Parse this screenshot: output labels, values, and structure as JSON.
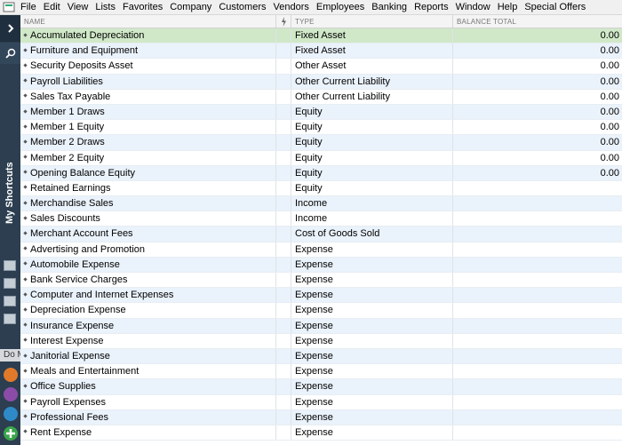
{
  "menu": [
    "File",
    "Edit",
    "View",
    "Lists",
    "Favorites",
    "Company",
    "Customers",
    "Vendors",
    "Employees",
    "Banking",
    "Reports",
    "Window",
    "Help",
    "Special Offers"
  ],
  "sidebar": {
    "title": "My Shortcuts",
    "do_label": "Do More"
  },
  "columns": {
    "name": "NAME",
    "type": "TYPE",
    "balance": "BALANCE TOTAL"
  },
  "accounts": [
    {
      "name": "Accumulated Depreciation",
      "type": "Fixed Asset",
      "balance": "0.00"
    },
    {
      "name": "Furniture and Equipment",
      "type": "Fixed Asset",
      "balance": "0.00"
    },
    {
      "name": "Security Deposits Asset",
      "type": "Other Asset",
      "balance": "0.00"
    },
    {
      "name": "Payroll Liabilities",
      "type": "Other Current Liability",
      "balance": "0.00"
    },
    {
      "name": "Sales Tax Payable",
      "type": "Other Current Liability",
      "balance": "0.00"
    },
    {
      "name": "Member 1 Draws",
      "type": "Equity",
      "balance": "0.00"
    },
    {
      "name": "Member 1 Equity",
      "type": "Equity",
      "balance": "0.00"
    },
    {
      "name": "Member 2 Draws",
      "type": "Equity",
      "balance": "0.00"
    },
    {
      "name": "Member 2 Equity",
      "type": "Equity",
      "balance": "0.00"
    },
    {
      "name": "Opening Balance Equity",
      "type": "Equity",
      "balance": "0.00"
    },
    {
      "name": "Retained Earnings",
      "type": "Equity",
      "balance": ""
    },
    {
      "name": "Merchandise Sales",
      "type": "Income",
      "balance": ""
    },
    {
      "name": "Sales Discounts",
      "type": "Income",
      "balance": ""
    },
    {
      "name": "Merchant Account Fees",
      "type": "Cost of Goods Sold",
      "balance": ""
    },
    {
      "name": "Advertising and Promotion",
      "type": "Expense",
      "balance": ""
    },
    {
      "name": "Automobile Expense",
      "type": "Expense",
      "balance": ""
    },
    {
      "name": "Bank Service Charges",
      "type": "Expense",
      "balance": ""
    },
    {
      "name": "Computer and Internet Expenses",
      "type": "Expense",
      "balance": ""
    },
    {
      "name": "Depreciation Expense",
      "type": "Expense",
      "balance": ""
    },
    {
      "name": "Insurance Expense",
      "type": "Expense",
      "balance": ""
    },
    {
      "name": "Interest Expense",
      "type": "Expense",
      "balance": ""
    },
    {
      "name": "Janitorial Expense",
      "type": "Expense",
      "balance": ""
    },
    {
      "name": "Meals and Entertainment",
      "type": "Expense",
      "balance": ""
    },
    {
      "name": "Office Supplies",
      "type": "Expense",
      "balance": ""
    },
    {
      "name": "Payroll Expenses",
      "type": "Expense",
      "balance": ""
    },
    {
      "name": "Professional Fees",
      "type": "Expense",
      "balance": ""
    },
    {
      "name": "Rent Expense",
      "type": "Expense",
      "balance": ""
    }
  ]
}
